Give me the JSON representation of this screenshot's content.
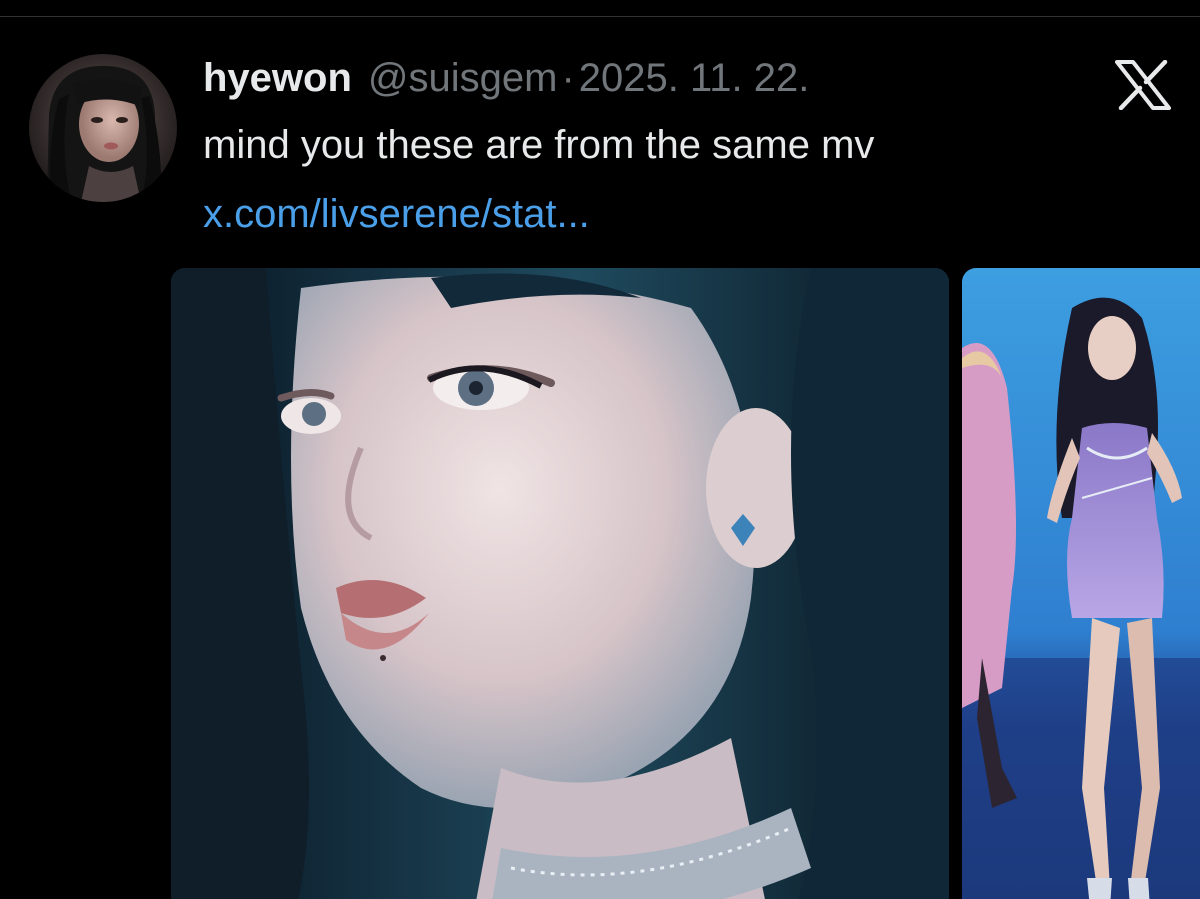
{
  "tweet": {
    "author_name": "hyewon",
    "author_handle": "@suisgem",
    "separator": "·",
    "date": "2025. 11. 22.",
    "text": "mind you these are from the same mv",
    "link_text": "x.com/livserene/stat..."
  },
  "icons": {
    "brand": "x-logo-icon",
    "avatar": "profile-avatar"
  },
  "media": [
    {
      "name": "photo-closeup"
    },
    {
      "name": "photo-stage-performance"
    }
  ],
  "colors": {
    "background": "#000000",
    "primary_text": "#e7e9ea",
    "secondary_text": "#71767b",
    "link": "#4a9fe8",
    "divider": "#2f3336"
  }
}
